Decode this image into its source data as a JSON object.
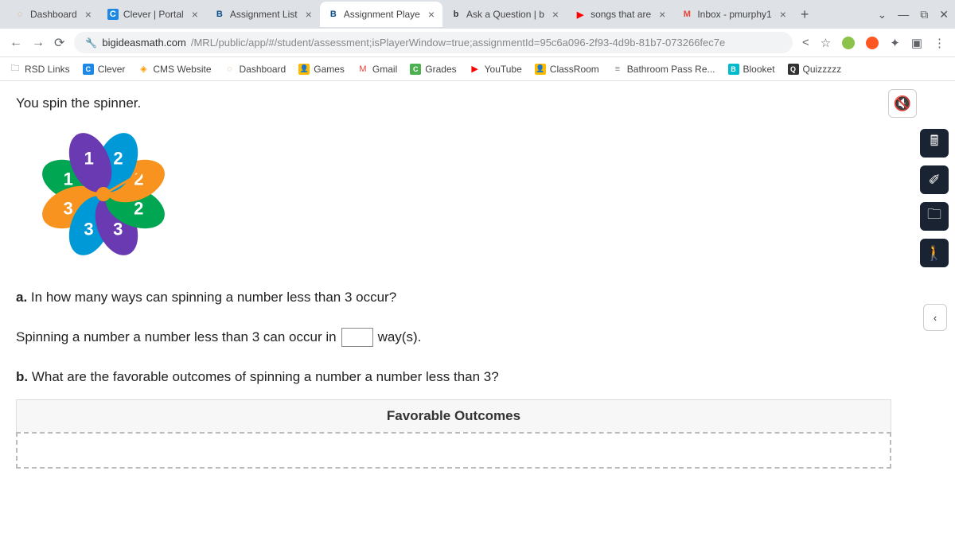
{
  "tabs": [
    {
      "icon": "◌",
      "iconColor": "#d94",
      "title": "Dashboard",
      "active": false
    },
    {
      "icon": "C",
      "iconColor": "#1e88e5",
      "iconBg": "#1e88e5",
      "title": "Clever | Portal",
      "active": false
    },
    {
      "icon": "B",
      "iconColor": "#0a4d8c",
      "title": "Assignment List",
      "active": false
    },
    {
      "icon": "B",
      "iconColor": "#0a4d8c",
      "title": "Assignment Playe",
      "active": true
    },
    {
      "icon": "b",
      "iconColor": "#333",
      "title": "Ask a Question | b",
      "active": false
    },
    {
      "icon": "▶",
      "iconColor": "#f00",
      "title": "songs that are",
      "active": false
    },
    {
      "icon": "M",
      "iconColor": "#ea4335",
      "title": "Inbox - pmurphy1",
      "active": false
    }
  ],
  "url": {
    "host": "bigideasmath.com",
    "path": "/MRL/public/app/#/student/assessment;isPlayerWindow=true;assignmentId=95c6a096-2f93-4d9b-81b7-073266fec7e"
  },
  "bookmarks": [
    {
      "icon": "🗀",
      "color": "#5f6368",
      "label": "RSD Links"
    },
    {
      "icon": "C",
      "color": "#1e88e5",
      "bg": true,
      "label": "Clever"
    },
    {
      "icon": "◈",
      "color": "#f90",
      "label": "CMS Website"
    },
    {
      "icon": "◌",
      "color": "#d94",
      "label": "Dashboard"
    },
    {
      "icon": "👤",
      "color": "#fb0",
      "bg": true,
      "label": "Games"
    },
    {
      "icon": "M",
      "color": "#ea4335",
      "label": "Gmail"
    },
    {
      "icon": "C",
      "color": "#4caf50",
      "bg": true,
      "label": "Grades"
    },
    {
      "icon": "▶",
      "color": "#f00",
      "label": "YouTube"
    },
    {
      "icon": "👤",
      "color": "#fb0",
      "bg": true,
      "label": "ClassRoom"
    },
    {
      "icon": "≡",
      "color": "#888",
      "label": "Bathroom Pass Re..."
    },
    {
      "icon": "B",
      "color": "#0bc",
      "bg": true,
      "label": "Blooket"
    },
    {
      "icon": "Q",
      "color": "#333",
      "bg": true,
      "label": "Quizzzzz"
    }
  ],
  "problem": {
    "intro": "You spin the spinner.",
    "petals": [
      {
        "num": "1",
        "color": "#6a3ab2",
        "rot": -22.5
      },
      {
        "num": "2",
        "color": "#0099d8",
        "rot": 22.5
      },
      {
        "num": "2",
        "color": "#f7931e",
        "rot": 67.5
      },
      {
        "num": "2",
        "color": "#00a651",
        "rot": 112.5
      },
      {
        "num": "3",
        "color": "#6a3ab2",
        "rot": 157.5
      },
      {
        "num": "3",
        "color": "#0099d8",
        "rot": 202.5
      },
      {
        "num": "3",
        "color": "#f7931e",
        "rot": 247.5
      },
      {
        "num": "1",
        "color": "#00a651",
        "rot": 292.5
      }
    ],
    "qa_label": "a.",
    "qa_text": "In how many ways can spinning a number less than 3 occur?",
    "answer_prefix": "Spinning a number a number less than 3 can occur in",
    "answer_suffix": "way(s).",
    "qb_label": "b.",
    "qb_text": "What are the favorable outcomes of spinning a number a number less than 3?",
    "table_header": "Favorable Outcomes"
  }
}
